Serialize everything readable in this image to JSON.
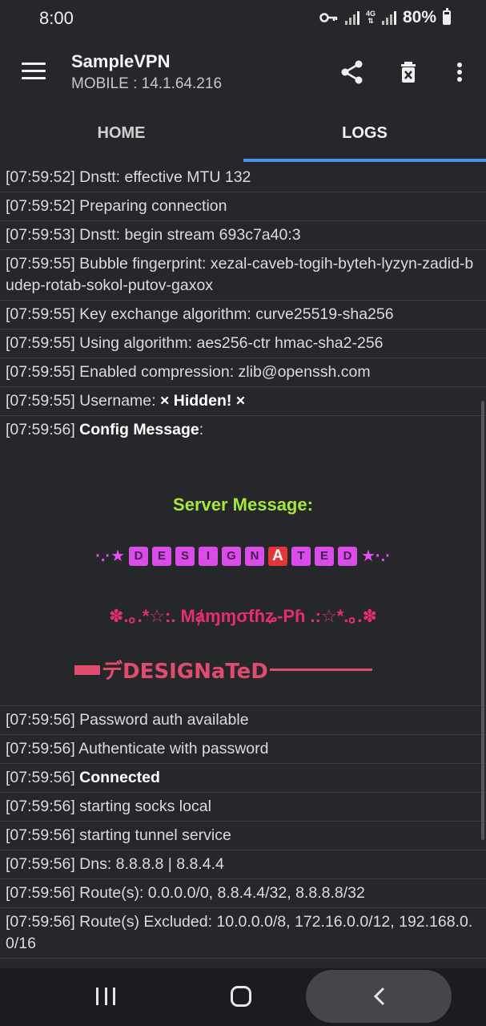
{
  "status_bar": {
    "time": "8:00",
    "battery": "80%",
    "network": "4G"
  },
  "app_bar": {
    "title": "SampleVPN",
    "subtitle": "MOBILE : 14.1.64.216"
  },
  "tabs": [
    {
      "label": "HOME"
    },
    {
      "label": "LOGS"
    }
  ],
  "logs_before": [
    {
      "time": "[07:59:52]",
      "text": "Dnstt: effective MTU 132"
    },
    {
      "time": "[07:59:52]",
      "text": "Preparing connection"
    },
    {
      "time": "[07:59:53]",
      "text": "Dnstt: begin stream 693c7a40:3"
    },
    {
      "time": "[07:59:55]",
      "text": "Bubble fingerprint: xezal-caveb-togih-byteh-lyzyn-zadid-budep-rotab-sokol-putov-gaxox"
    },
    {
      "time": "[07:59:55]",
      "text": "Key exchange algorithm: curve25519-sha256"
    },
    {
      "time": "[07:59:55]",
      "text": "Using algorithm: aes256-ctr hmac-sha2-256"
    },
    {
      "time": "[07:59:55]",
      "text": "Enabled compression: zlib@openssh.com"
    },
    {
      "time": "[07:59:55]",
      "prefix": "Username: ",
      "bold": "× Hidden! ×"
    }
  ],
  "config_message": {
    "time": "[07:59:56]",
    "label": "Config Message",
    "server_title": "Server Message:",
    "line1_left": "·.·★",
    "line1_right": "★·.·",
    "line1_letters": [
      "D",
      "E",
      "S",
      "I",
      "G",
      "N",
      "A",
      "T",
      "E",
      "D"
    ],
    "line2": "✽.｡.*☆:. Mⱥɱɱσƭɦʑ-Pɦ .:☆*.｡.✽",
    "line3": "デDESIGNaTeD"
  },
  "logs_after": [
    {
      "time": "[07:59:56]",
      "text": "Password auth available"
    },
    {
      "time": "[07:59:56]",
      "text": "Authenticate with password"
    },
    {
      "time": "[07:59:56]",
      "bold": "Connected"
    },
    {
      "time": "[07:59:56]",
      "text": "starting socks local"
    },
    {
      "time": "[07:59:56]",
      "text": "starting tunnel service"
    },
    {
      "time": "[07:59:56]",
      "text": "Dns: 8.8.8.8 | 8.8.4.4"
    },
    {
      "time": "[07:59:56]",
      "text": "Route(s): 0.0.0.0/0, 8.8.4.4/32, 8.8.8.8/32"
    },
    {
      "time": "[07:59:56]",
      "text": "Route(s) Excluded: 10.0.0.0/8, 172.16.0.0/12, 192.168.0.0/16"
    }
  ]
}
